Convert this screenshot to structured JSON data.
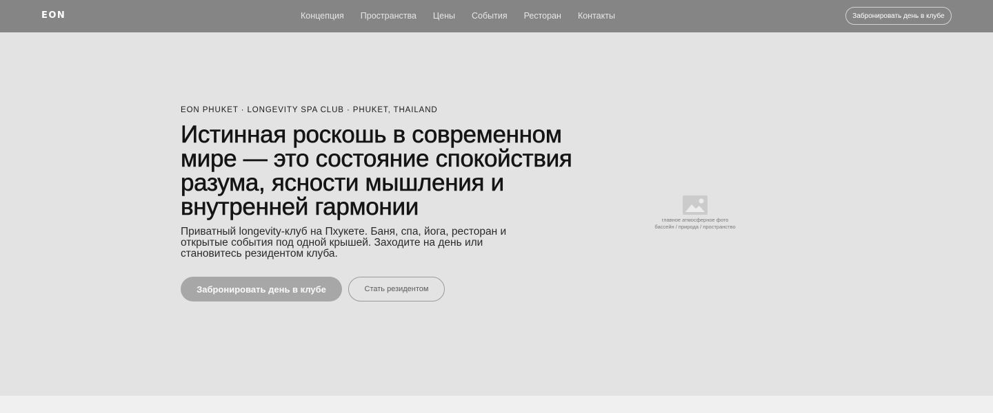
{
  "header": {
    "logo": "EON",
    "nav": [
      "Концепция",
      "Пространства",
      "Цены",
      "События",
      "Ресторан",
      "Контакты"
    ],
    "cta_label": "Забронировать день в клубе"
  },
  "hero": {
    "eyebrow": "EON PHUKET · LONGEVITY SPA CLUB · PHUKET, THAILAND",
    "headline": "Истинная роскошь в современном мире — это состояние спокойствия разума, ясности мышления и внутренней гармонии",
    "lead": "Приватный longevity-клуб на Пхукете. Баня, спа, йога, ресторан и открытые события под одной крышей. Заходите на день или становитесь резидентом клуба.",
    "primary_button": "Забронировать день в клубе",
    "secondary_button": "Стать резидентом",
    "photo_placeholder": {
      "icon": "image-icon",
      "caption_line1": "главное атмосферное фото",
      "caption_line2": "бассейн / природа / пространство"
    }
  },
  "colors": {
    "header_bg": "#858585",
    "hero_bg": "#e3e3e3",
    "primary_button_bg": "#a7a7a7",
    "page_bg": "#f0f0f0"
  }
}
